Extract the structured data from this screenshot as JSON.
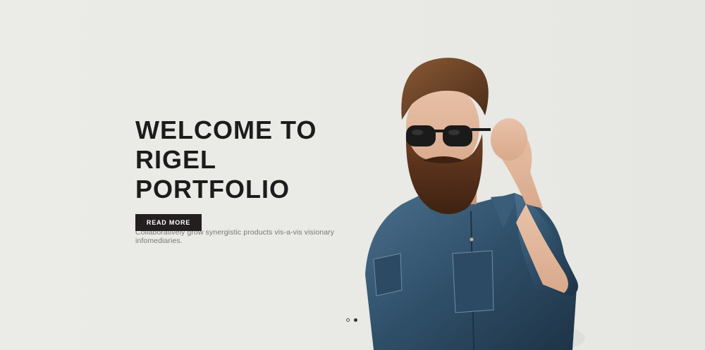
{
  "hero": {
    "title": "WELCOME TO\nRIGEL PORTFOLIO",
    "subtitle": "Collaboratively grow synergistic products vis-a-vis visionary infomediaries.",
    "button_label": "READ MORE",
    "image_icon": "bearded-man-photo"
  },
  "slider": {
    "slide_count": 2,
    "active_index": 1
  },
  "colors": {
    "background": "#e9e9e5",
    "title": "#1c1c1c",
    "button_bg": "#231f20",
    "button_text": "#ffffff",
    "subtitle": "#777777"
  }
}
